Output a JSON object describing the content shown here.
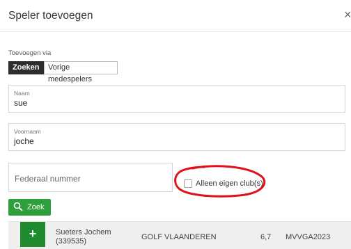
{
  "dialog": {
    "title": "Speler toevoegen",
    "close_label": "×"
  },
  "add_via": {
    "label": "Toevoegen via",
    "options": [
      "Zoeken",
      "Vorige medespelers"
    ],
    "selected": "Zoeken"
  },
  "form": {
    "naam": {
      "label": "Naam",
      "value": "sue"
    },
    "voornaam": {
      "label": "Voornaam",
      "value": "joche"
    },
    "federaal": {
      "placeholder": "Federaal nummer"
    },
    "own_club": {
      "label": "Alleen eigen club(s)",
      "checked": false
    }
  },
  "search_button": {
    "label": "Zoek",
    "icon": "search-icon",
    "color": "#2e9f3c"
  },
  "results": [
    {
      "add_label": "+",
      "name": "Sueters Jochem",
      "id": "(339535)",
      "club": "GOLF VLAANDEREN",
      "handicap": "6,7",
      "code": "MVVGA2023"
    }
  ],
  "annotation": {
    "color": "#e0101a",
    "shape": "hand-drawn ellipse"
  }
}
